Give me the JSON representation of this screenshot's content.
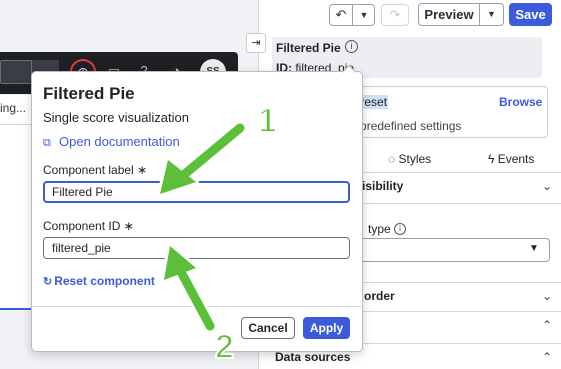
{
  "colors": {
    "accent": "#3c5bdc",
    "annotation_green": "#5cbf3a",
    "annotation_outline": "#ffffff",
    "toolbar_dark": "#1e2024",
    "highlight": "#cfe0f7"
  },
  "header": {
    "undo_icon": "undo-icon",
    "redo_icon": "redo-icon",
    "preview_label": "Preview",
    "save_label": "Save"
  },
  "canvas": {
    "toolbar_avatar": "SS",
    "card_text": "ing..."
  },
  "component": {
    "title": "Filtered Pie",
    "id_label": "ID:",
    "id_value": "filtered_pie"
  },
  "preset": {
    "title": "le a preset",
    "browse_label": "Browse",
    "subtitle": "apply predefined settings"
  },
  "tabs": {
    "styles_label": "Styles",
    "events_label": "Events"
  },
  "sections": {
    "visibility_label": "isibility",
    "type_label": "type",
    "border_label": "order",
    "data_sources_label": "Data sources"
  },
  "modal": {
    "title": "Filtered Pie",
    "subtitle": "Single score visualization",
    "doc_link": "Open documentation",
    "label_field": "Component label",
    "label_value": "Filtered Pie",
    "id_field": "Component ID",
    "id_value": "filtered_pie",
    "required_mark": "∗",
    "reset_label": "Reset component",
    "cancel_label": "Cancel",
    "apply_label": "Apply"
  },
  "annotations": {
    "arrow1_number": "1",
    "arrow2_number": "2"
  }
}
